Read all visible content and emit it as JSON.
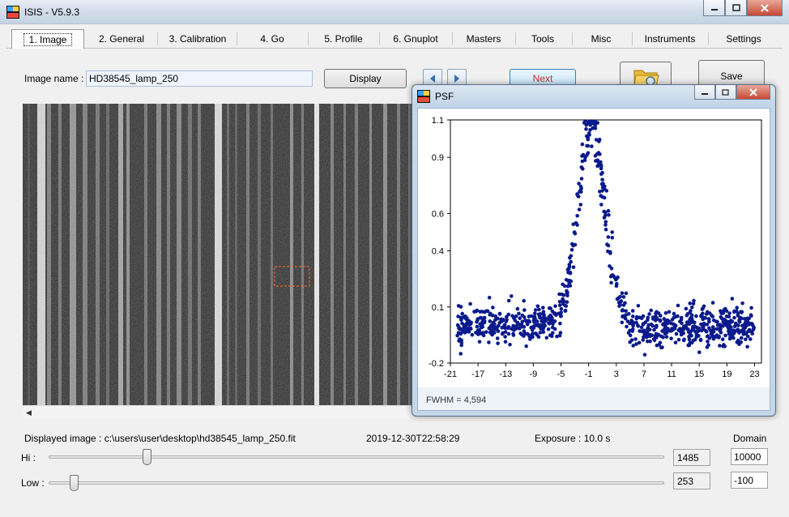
{
  "main_window": {
    "title": "ISIS - V5.9.3",
    "tabs": [
      "1. Image",
      "2. General",
      "3. Calibration",
      "4. Go",
      "5. Profile",
      "6. Gnuplot",
      "Masters",
      "Tools",
      "Misc",
      "Instruments",
      "Settings"
    ],
    "active_tab": "1. Image"
  },
  "form": {
    "image_name_label": "Image name :",
    "image_name_value": "HD38545_lamp_250",
    "display_label": "Display",
    "next_label": "Next",
    "save_label": "Save"
  },
  "status": {
    "displayed_image": "Displayed image : c:\\users\\user\\desktop\\hd38545_lamp_250.fit",
    "datetime": "2019-12-30T22:58:29",
    "exposure": "Exposure : 10.0 s",
    "domain_label": "Domain"
  },
  "sliders": {
    "hi_label": "Hi :",
    "low_label": "Low :",
    "hi_value": "1485",
    "low_value": "253",
    "domain_hi": "10000",
    "domain_low": "-100"
  },
  "psf_window": {
    "title": "PSF",
    "fwhm": "FWHM = 4,594"
  },
  "chart_data": {
    "type": "scatter",
    "title": "",
    "xlabel": "",
    "ylabel": "",
    "xlim": [
      -21,
      24
    ],
    "ylim": [
      -0.2,
      1.1
    ],
    "x_ticks": [
      -21,
      -17,
      -13,
      -9,
      -5,
      -1,
      3,
      7,
      11,
      15,
      19,
      23
    ],
    "y_ticks": [
      -0.2,
      0.1,
      0.4,
      0.6,
      0.9,
      1.1
    ],
    "grid": false,
    "series": [
      {
        "color": "#0b1a8c",
        "profile": "gaussian",
        "baseline": 0.0,
        "peak_x": -0.6,
        "peak_y": 1.05,
        "x_range": [
          -20,
          23
        ],
        "y_scatter": 0.05,
        "n_points": 900
      }
    ]
  },
  "colors": {
    "accent": "#0b1a8c",
    "selection_box": "#ff6a2a",
    "next_text": "#c0392b"
  }
}
